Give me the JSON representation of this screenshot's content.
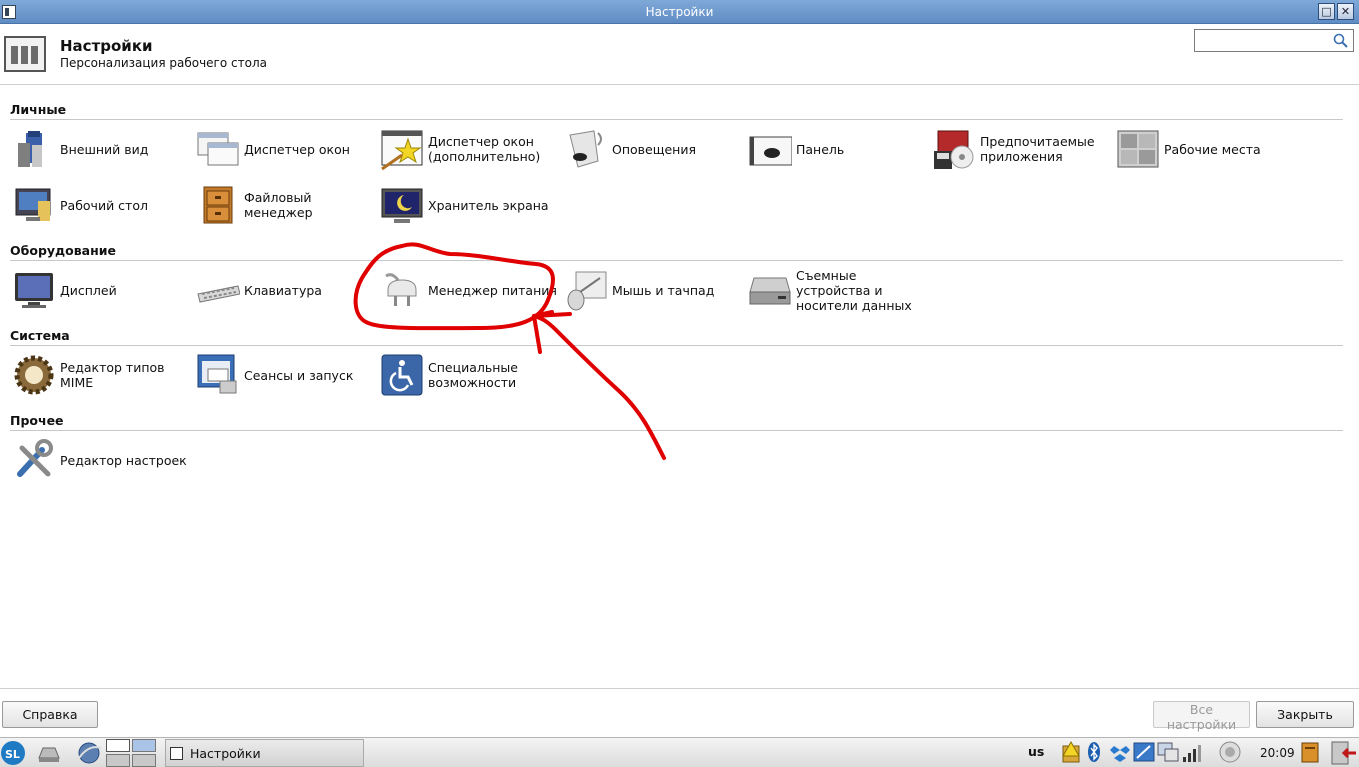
{
  "window": {
    "title": "Настройки"
  },
  "header": {
    "title": "Настройки",
    "subtitle": "Персонализация рабочего стола",
    "search_value": ""
  },
  "sections": {
    "personal": {
      "title": "Личные",
      "items": [
        {
          "label": "Внешний вид",
          "icon": "appearance-icon"
        },
        {
          "label": "Диспетчер окон",
          "icon": "window-manager-icon"
        },
        {
          "label": "Диспетчер окон\n(дополнительно)",
          "icon": "window-manager-tweaks-icon"
        },
        {
          "label": "Оповещения",
          "icon": "notifications-icon"
        },
        {
          "label": "Панель",
          "icon": "panel-icon"
        },
        {
          "label": "Предпочитаемые\nприложения",
          "icon": "preferred-apps-icon"
        },
        {
          "label": "Рабочие места",
          "icon": "workspaces-icon"
        },
        {
          "label": "Рабочий стол",
          "icon": "desktop-icon"
        },
        {
          "label": "Файловый\nменеджер",
          "icon": "file-manager-icon"
        },
        {
          "label": "Хранитель экрана",
          "icon": "screensaver-icon"
        }
      ]
    },
    "hardware": {
      "title": "Оборудование",
      "items": [
        {
          "label": "Дисплей",
          "icon": "display-icon"
        },
        {
          "label": "Клавиатура",
          "icon": "keyboard-icon"
        },
        {
          "label": "Менеджер питания",
          "icon": "power-plug-icon"
        },
        {
          "label": "Мышь и тачпад",
          "icon": "mouse-icon"
        },
        {
          "label": "Съемные\nустройства и\nносители данных",
          "icon": "removable-drive-icon"
        }
      ]
    },
    "system": {
      "title": "Система",
      "items": [
        {
          "label": "Редактор типов\nMIME",
          "icon": "mime-gear-icon"
        },
        {
          "label": "Сеансы и запуск",
          "icon": "sessions-icon"
        },
        {
          "label": "Специальные\nвозможности",
          "icon": "accessibility-icon"
        }
      ]
    },
    "other": {
      "title": "Прочее",
      "items": [
        {
          "label": "Редактор настроек",
          "icon": "settings-editor-icon"
        }
      ]
    }
  },
  "footer": {
    "help_label": "Справка",
    "all_settings_label": "Все настройки",
    "close_label": "Закрыть"
  },
  "taskbar": {
    "task_label": "Настройки",
    "keyboard_layout": "us",
    "clock": "20:09"
  },
  "colors": {
    "annotation_red": "#e00000",
    "titlebar_blue": "#6f9bd0"
  }
}
